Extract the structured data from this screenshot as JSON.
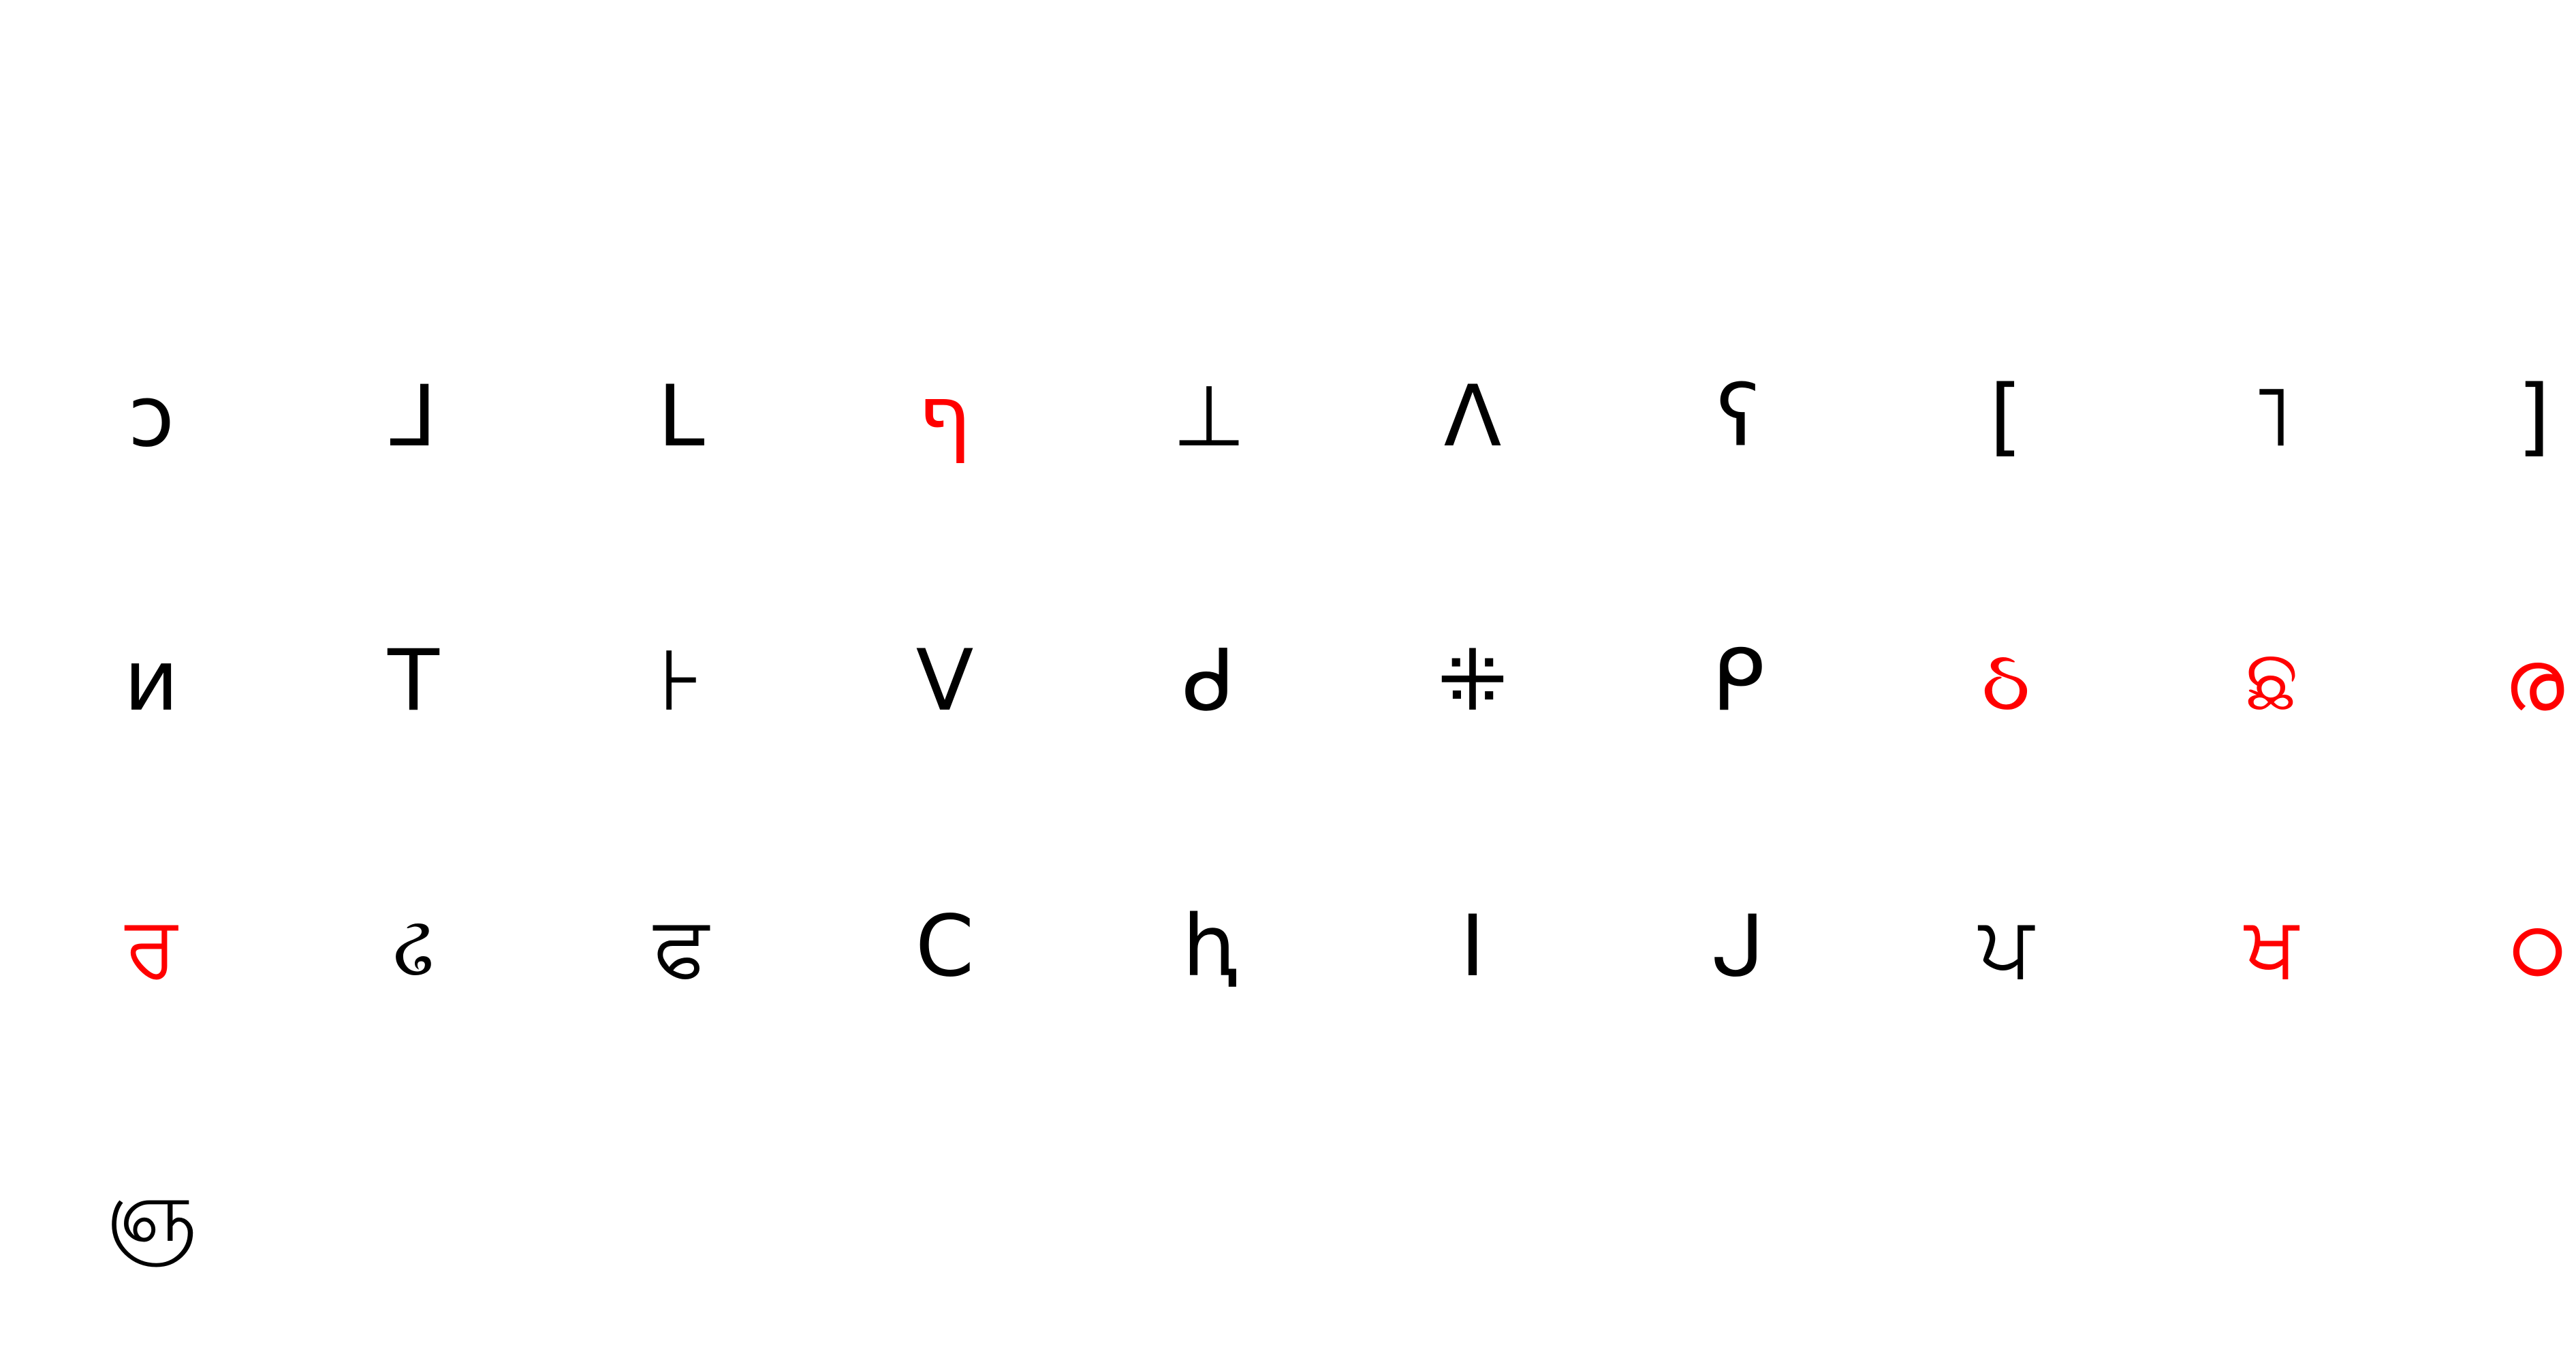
{
  "colors": {
    "background": "#ffffff",
    "normal": "#000000",
    "highlight": "#ff0000"
  },
  "rows": [
    [
      {
        "char": "ↄ",
        "highlight": false
      },
      {
        "char": "⅃",
        "highlight": false
      },
      {
        "char": "L",
        "highlight": false
      },
      {
        "char": "ף",
        "highlight": true
      },
      {
        "char": "⊥",
        "highlight": false
      },
      {
        "char": "Λ",
        "highlight": false
      },
      {
        "char": "ʕ",
        "highlight": false
      },
      {
        "char": "[",
        "highlight": false
      },
      {
        "char": "˥",
        "highlight": false
      },
      {
        "char": "]",
        "highlight": false
      }
    ],
    [
      {
        "char": "ᴎ",
        "highlight": false
      },
      {
        "char": "T",
        "highlight": false
      },
      {
        "char": "⊦",
        "highlight": false
      },
      {
        "char": "V",
        "highlight": false
      },
      {
        "char": "ᑯ",
        "highlight": false
      },
      {
        "char": "⁜",
        "highlight": false
      },
      {
        "char": "ᑭ",
        "highlight": false
      },
      {
        "char": "ઠ",
        "highlight": true
      },
      {
        "char": "ଛ",
        "highlight": true
      },
      {
        "char": "ര",
        "highlight": true
      }
    ],
    [
      {
        "char": "ਰ",
        "highlight": true
      },
      {
        "char": "ઢ",
        "highlight": false
      },
      {
        "char": "ਫ",
        "highlight": false
      },
      {
        "char": "C",
        "highlight": false
      },
      {
        "char": "ⱨ",
        "highlight": false
      },
      {
        "char": "I",
        "highlight": false
      },
      {
        "char": "ᒍ",
        "highlight": false
      },
      {
        "char": "ਪ",
        "highlight": false
      },
      {
        "char": "ਖ",
        "highlight": true
      },
      {
        "char": "ഠ",
        "highlight": true
      }
    ],
    [
      {
        "char": "ஞ",
        "highlight": false
      }
    ]
  ]
}
